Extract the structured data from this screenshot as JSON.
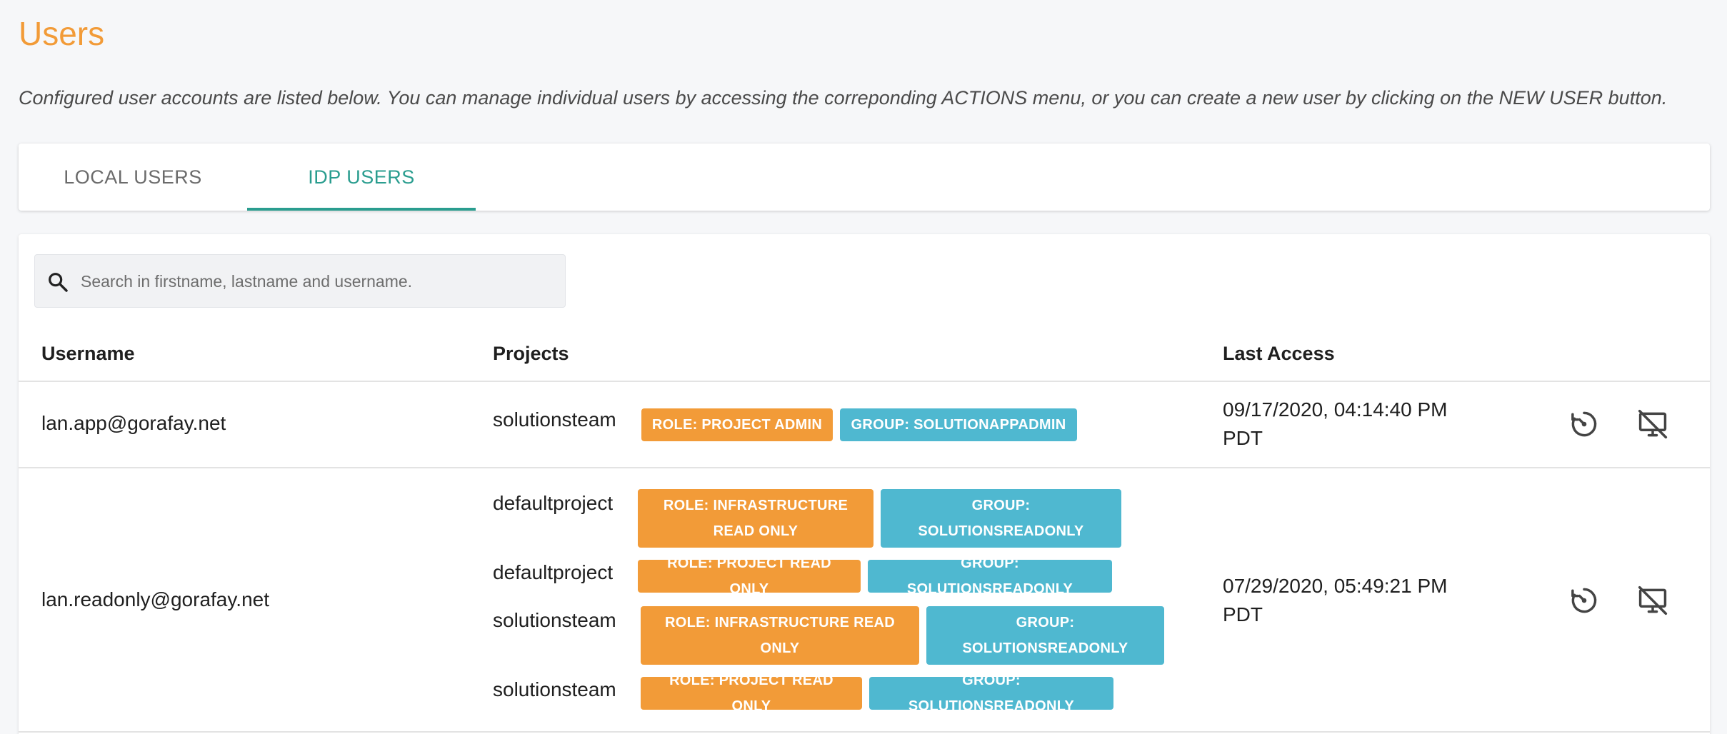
{
  "page": {
    "title": "Users",
    "description": "Configured user accounts are listed below. You can manage individual users by accessing the correponding ACTIONS menu, or you can create a new user by clicking on the NEW USER button."
  },
  "tabs": [
    {
      "label": "LOCAL USERS",
      "active": false
    },
    {
      "label": "IDP USERS",
      "active": true
    }
  ],
  "colors": {
    "title": "#f29b38",
    "active_tab": "#2a9d8f",
    "role_badge": "#f29b38",
    "group_badge": "#4fb8d0"
  },
  "search": {
    "placeholder": "Search in firstname, lastname and username.",
    "value": ""
  },
  "table": {
    "headers": {
      "username": "Username",
      "projects": "Projects",
      "last_access": "Last Access"
    },
    "rows": [
      {
        "username": "lan.app@gorafay.net",
        "projects": [
          {
            "name": "solutionsteam",
            "role": "ROLE: PROJECT ADMIN",
            "group": "GROUP: SOLUTIONAPPADMIN"
          }
        ],
        "last_access_line1": "09/17/2020, 04:14:40 PM",
        "last_access_line2": "PDT",
        "actions": [
          "timer-reset-icon",
          "desktop-off-icon"
        ]
      },
      {
        "username": "lan.readonly@gorafay.net",
        "projects": [
          {
            "name": "defaultproject",
            "role": "ROLE: INFRASTRUCTURE READ ONLY",
            "group": "GROUP: SOLUTIONSREADONLY"
          },
          {
            "name": "defaultproject",
            "role": "ROLE: PROJECT READ ONLY",
            "group": "GROUP: SOLUTIONSREADONLY"
          },
          {
            "name": "solutionsteam",
            "role": "ROLE: INFRASTRUCTURE READ ONLY",
            "group": "GROUP: SOLUTIONSREADONLY"
          },
          {
            "name": "solutionsteam",
            "role": "ROLE: PROJECT READ ONLY",
            "group": "GROUP: SOLUTIONSREADONLY"
          }
        ],
        "last_access_line1": "07/29/2020, 05:49:21 PM",
        "last_access_line2": "PDT",
        "actions": [
          "timer-reset-icon",
          "desktop-off-icon"
        ]
      }
    ]
  }
}
